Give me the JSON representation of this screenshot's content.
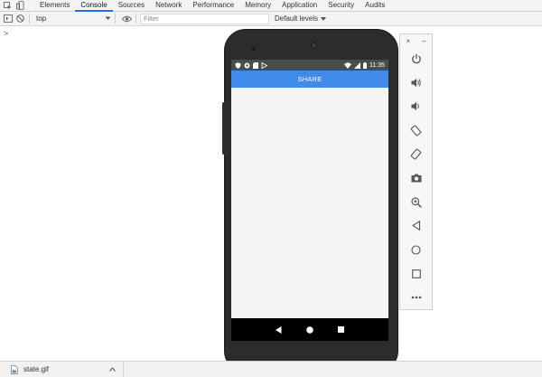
{
  "devtools": {
    "tabs": [
      {
        "label": "Elements"
      },
      {
        "label": "Console",
        "active": true
      },
      {
        "label": "Sources"
      },
      {
        "label": "Network"
      },
      {
        "label": "Performance"
      },
      {
        "label": "Memory"
      },
      {
        "label": "Application"
      },
      {
        "label": "Security"
      },
      {
        "label": "Audits"
      }
    ],
    "toolbar": {
      "context": "top",
      "filter_placeholder": "Filter",
      "levels_label": "Default levels"
    },
    "prompt_symbol": ">",
    "accent_color": "#1a73e8"
  },
  "phone": {
    "status_time": "11:35",
    "share_label": "SHARE",
    "share_bar_color": "#3f8aeb",
    "status_bar_color": "#4b4b4b"
  },
  "emulator_panel": {
    "buttons": [
      "power-icon",
      "volume-up-icon",
      "volume-down-icon",
      "rotate-left-icon",
      "rotate-right-icon",
      "camera-icon",
      "zoom-icon",
      "back-icon",
      "home-icon",
      "overview-icon",
      "more-icon"
    ]
  },
  "downloads": {
    "file_name": "state.gif"
  }
}
